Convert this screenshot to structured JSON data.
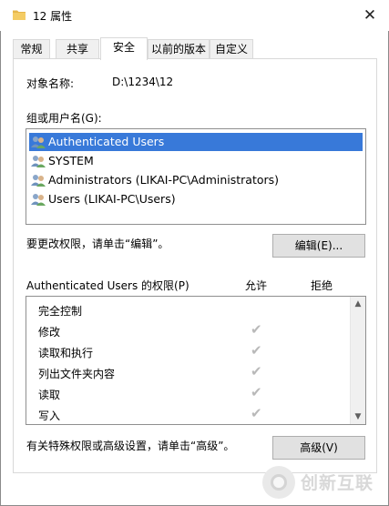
{
  "window": {
    "title": "12 属性",
    "close_glyph": "✕"
  },
  "tabs": [
    {
      "label": "常规",
      "active": false
    },
    {
      "label": "共享",
      "active": false
    },
    {
      "label": "安全",
      "active": true
    },
    {
      "label": "以前的版本",
      "active": false
    },
    {
      "label": "自定义",
      "active": false
    }
  ],
  "security": {
    "object_name_label": "对象名称:",
    "object_name_value": "D:\\1234\\12",
    "groups_label": "组或用户名(G):",
    "users": [
      {
        "name": "Authenticated Users",
        "selected": true,
        "icon": "users-group-icon"
      },
      {
        "name": "SYSTEM",
        "selected": false,
        "icon": "users-group-icon"
      },
      {
        "name": "Administrators (LIKAI-PC\\Administrators)",
        "selected": false,
        "icon": "users-group-icon"
      },
      {
        "name": "Users (LIKAI-PC\\Users)",
        "selected": false,
        "icon": "users-group-icon"
      }
    ],
    "edit_hint": "要更改权限，请单击“编辑”。",
    "edit_button": "编辑(E)...",
    "permissions_title": "Authenticated Users 的权限(P)",
    "allow_header": "允许",
    "deny_header": "拒绝",
    "permissions": [
      {
        "name": "完全控制",
        "allow": false
      },
      {
        "name": "修改",
        "allow": true
      },
      {
        "name": "读取和执行",
        "allow": true
      },
      {
        "name": "列出文件夹内容",
        "allow": true
      },
      {
        "name": "读取",
        "allow": true
      },
      {
        "name": "写入",
        "allow": true
      }
    ],
    "check_glyph": "✔",
    "advanced_hint": "有关特殊权限或高级设置，请单击“高级”。",
    "advanced_button": "高级(V)"
  },
  "watermark": {
    "text": "创新互联"
  },
  "colors": {
    "selection": "#3879d9",
    "button_bg": "#e1e1e1",
    "check_gray": "#b9b9b9"
  }
}
